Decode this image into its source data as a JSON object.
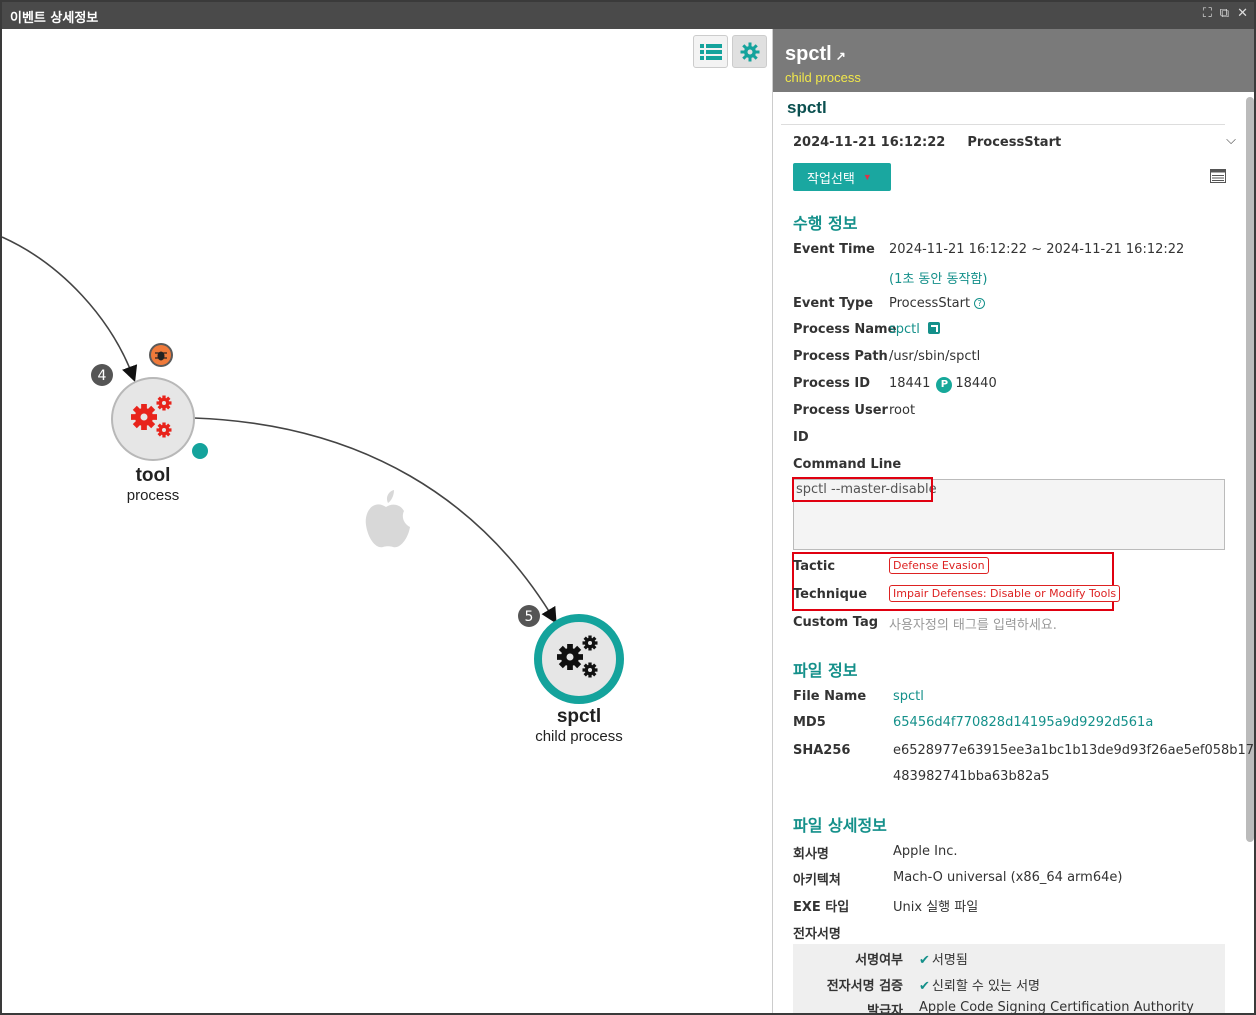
{
  "window": {
    "title": "이벤트 상세정보",
    "controls": {
      "expand": "⛶",
      "popout": "⧉",
      "close": "✕"
    }
  },
  "graph": {
    "nodes": [
      {
        "id": "tool",
        "name": "tool",
        "type": "process",
        "badge": "4",
        "color": "#e8231b"
      },
      {
        "id": "spctl",
        "name": "spctl",
        "type": "child process",
        "badge": "5",
        "color": "#111111"
      }
    ],
    "toolbar": {
      "list_icon": "list-icon",
      "gear_icon": "gear-icon"
    },
    "accent": "#14a39c"
  },
  "panel": {
    "header": {
      "name": "spctl",
      "type": "child process"
    },
    "title": "spctl",
    "event": {
      "time": "2024-11-21 16:12:22",
      "type": "ProcessStart"
    },
    "action_button": "작업선택",
    "exec_info": {
      "section": "수행 정보",
      "event_time_label": "Event Time",
      "event_time": "2024-11-21 16:12:22 ~ 2024-11-21 16:12:22",
      "duration": "(1초 동안 동작함)",
      "event_type_label": "Event Type",
      "event_type": "ProcessStart",
      "process_name_label": "Process Name",
      "process_name": "spctl",
      "process_path_label": "Process Path",
      "process_path": "/usr/sbin/spctl",
      "process_id_label": "Process ID",
      "process_id": "18441",
      "parent_badge": "P",
      "parent_id": "18440",
      "process_user_label": "Process User",
      "process_user": "root",
      "id_label": "ID",
      "command_line_label": "Command Line",
      "command_line": "spctl --master-disable",
      "tactic_label": "Tactic",
      "tactic": "Defense Evasion",
      "technique_label": "Technique",
      "technique": "Impair Defenses: Disable or Modify Tools",
      "custom_tag_label": "Custom Tag",
      "custom_tag_placeholder": "사용자정의 태그를 입력하세요."
    },
    "file_info": {
      "section": "파일 정보",
      "file_name_label": "File Name",
      "file_name": "spctl",
      "md5_label": "MD5",
      "md5": "65456d4f770828d14195a9d9292d561a",
      "sha256_label": "SHA256",
      "sha256_line1": "e6528977e63915ee3a1bc1b13de9d93f26ae5ef058b17",
      "sha256_line2": "483982741bba63b82a5"
    },
    "file_detail": {
      "section": "파일 상세정보",
      "company_label": "회사명",
      "company": "Apple Inc.",
      "arch_label": "아키텍쳐",
      "arch": "Mach-O universal (x86_64 arm64e)",
      "exe_label": "EXE 타입",
      "exe": "Unix 실행 파일",
      "sig_label": "전자서명",
      "signed_label": "서명여부",
      "signed": "서명됨",
      "verify_label": "전자서명 검증",
      "verify": "신뢰할 수 있는 서명",
      "issuer_label": "발급자",
      "issuer": "Apple Code Signing Certification Authority"
    }
  }
}
